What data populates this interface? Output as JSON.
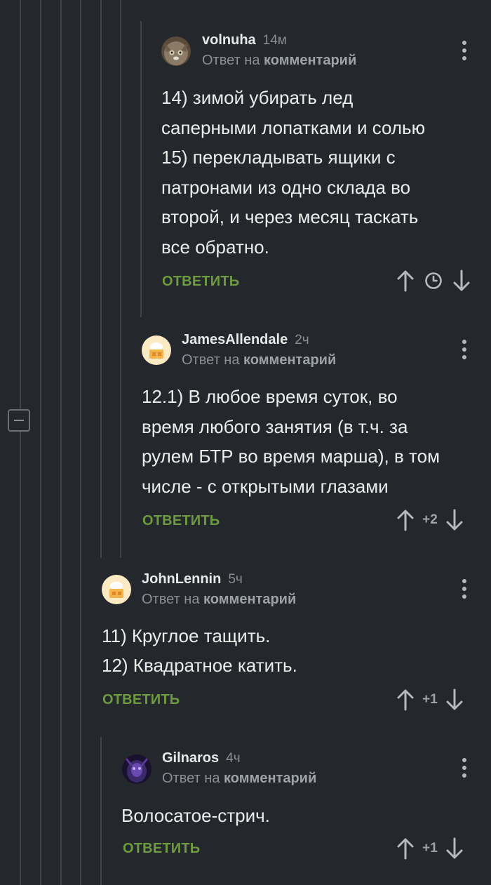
{
  "comments": [
    {
      "username": "volnuha",
      "time": "14м",
      "reply_prefix": "Ответ на",
      "reply_target": "комментарий",
      "lines": [
        "14) зимой убирать лед",
        "саперными лопатками и солью",
        "15) перекладывать ящики с",
        "патронами из одно склада во",
        "второй, и через месяц таскать",
        "все обратно."
      ],
      "reply_label": "ОТВЕТИТЬ",
      "rating": ""
    },
    {
      "username": "JamesAllendale",
      "time": "2ч",
      "reply_prefix": "Ответ на",
      "reply_target": "комментарий",
      "lines": [
        "12.1) В любое время суток, во",
        "время любого занятия (в т.ч. за",
        "рулем БТР во время марша), в том",
        "числе - с открытыми глазами"
      ],
      "reply_label": "ОТВЕТИТЬ",
      "rating": "+2"
    },
    {
      "username": "JohnLennin",
      "time": "5ч",
      "reply_prefix": "Ответ на",
      "reply_target": "комментарий",
      "lines": [
        "11) Круглое тащить.",
        "12) Квадратное катить."
      ],
      "reply_label": "ОТВЕТИТЬ",
      "rating": "+1"
    },
    {
      "username": "Gilnaros",
      "time": "4ч",
      "reply_prefix": "Ответ на",
      "reply_target": "комментарий",
      "lines": [
        "Волосатое-стрич."
      ],
      "reply_label": "ОТВЕТИТЬ",
      "rating": "+1"
    }
  ],
  "icons": {
    "upvote": "arrow-up-icon",
    "downvote": "arrow-down-icon",
    "pending": "clock-icon",
    "menu": "more-vertical-icon",
    "collapse": "collapse-icon"
  },
  "colors": {
    "background": "#24272c",
    "thread_line": "#3f434a",
    "reply_green": "#6d9b3f",
    "muted": "#8b8f96"
  }
}
